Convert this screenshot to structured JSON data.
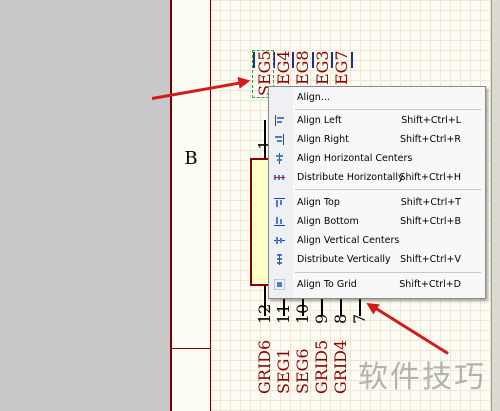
{
  "sheet": {
    "zone_label": "B"
  },
  "pins_top": [
    {
      "name": "SEG5",
      "selected": true
    },
    {
      "name": "SEG4"
    },
    {
      "name": "SEG8"
    },
    {
      "name": "SEG3"
    },
    {
      "name": "SEG7"
    }
  ],
  "pin_number_top": "1",
  "pins_bottom": [
    {
      "num": "12",
      "name": "GRID6"
    },
    {
      "num": "11",
      "name": "SEG1"
    },
    {
      "num": "10",
      "name": "SEG6"
    },
    {
      "num": "9",
      "name": "GRID5"
    },
    {
      "num": "8",
      "name": "GRID4"
    },
    {
      "num": "7",
      "name": ""
    }
  ],
  "context_menu": {
    "items": [
      {
        "label": "Align...",
        "shortcut": "",
        "icon": "align-icon"
      },
      {
        "label": "Align Left",
        "shortcut": "Shift+Ctrl+L",
        "icon": "align-left-icon"
      },
      {
        "label": "Align Right",
        "shortcut": "Shift+Ctrl+R",
        "icon": "align-right-icon"
      },
      {
        "label": "Align Horizontal Centers",
        "shortcut": "",
        "icon": "align-horizontal-centers-icon"
      },
      {
        "label": "Distribute Horizontally",
        "shortcut": "Shift+Ctrl+H",
        "icon": "distribute-horizontally-icon"
      },
      {
        "label": "Align Top",
        "shortcut": "Shift+Ctrl+T",
        "icon": "align-top-icon"
      },
      {
        "label": "Align Bottom",
        "shortcut": "Shift+Ctrl+B",
        "icon": "align-bottom-icon"
      },
      {
        "label": "Align Vertical Centers",
        "shortcut": "",
        "icon": "align-vertical-centers-icon"
      },
      {
        "label": "Distribute Vertically",
        "shortcut": "Shift+Ctrl+V",
        "icon": "distribute-vertically-icon"
      },
      {
        "label": "Align To Grid",
        "shortcut": "Shift+Ctrl+D",
        "icon": "align-to-grid-icon"
      }
    ]
  },
  "watermark": "软件技巧",
  "colors": {
    "pin_name": "#8b0000",
    "arrow": "#d21c1c",
    "menu_bg": "#f8f8f8"
  }
}
